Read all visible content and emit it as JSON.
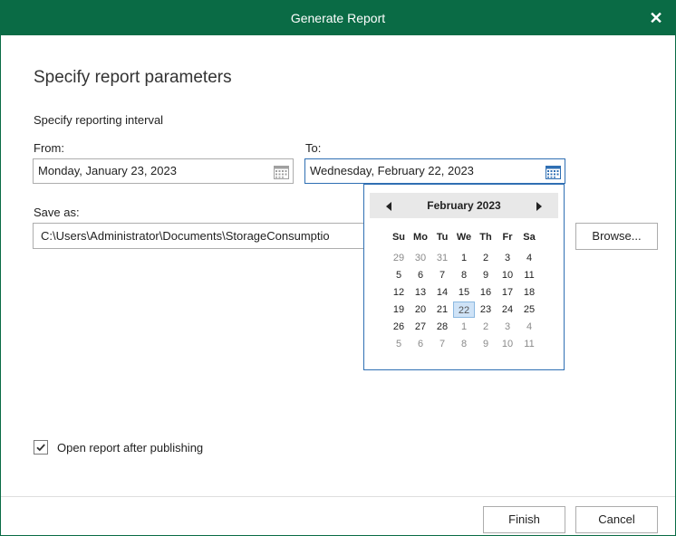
{
  "dialog": {
    "title": "Generate Report",
    "close_glyph": "✕"
  },
  "heading": "Specify report parameters",
  "interval_label": "Specify reporting interval",
  "from": {
    "label": "From:",
    "value": "Monday, January 23, 2023"
  },
  "to": {
    "label": "To:",
    "value": "Wednesday, February 22, 2023"
  },
  "save_as": {
    "label": "Save as:",
    "value": "C:\\Users\\Administrator\\Documents\\StorageConsumptio",
    "browse_label": "Browse..."
  },
  "calendar": {
    "month_label": "February 2023",
    "weekdays": [
      "Su",
      "Mo",
      "Tu",
      "We",
      "Th",
      "Fr",
      "Sa"
    ],
    "selected_day": "22",
    "weeks": [
      [
        {
          "d": "29",
          "o": true
        },
        {
          "d": "30",
          "o": true
        },
        {
          "d": "31",
          "o": true
        },
        {
          "d": "1"
        },
        {
          "d": "2"
        },
        {
          "d": "3"
        },
        {
          "d": "4"
        }
      ],
      [
        {
          "d": "5"
        },
        {
          "d": "6"
        },
        {
          "d": "7"
        },
        {
          "d": "8"
        },
        {
          "d": "9"
        },
        {
          "d": "10"
        },
        {
          "d": "11"
        }
      ],
      [
        {
          "d": "12"
        },
        {
          "d": "13"
        },
        {
          "d": "14"
        },
        {
          "d": "15"
        },
        {
          "d": "16"
        },
        {
          "d": "17"
        },
        {
          "d": "18"
        }
      ],
      [
        {
          "d": "19"
        },
        {
          "d": "20"
        },
        {
          "d": "21"
        },
        {
          "d": "22",
          "s": true
        },
        {
          "d": "23"
        },
        {
          "d": "24"
        },
        {
          "d": "25"
        }
      ],
      [
        {
          "d": "26"
        },
        {
          "d": "27"
        },
        {
          "d": "28"
        },
        {
          "d": "1",
          "o": true
        },
        {
          "d": "2",
          "o": true
        },
        {
          "d": "3",
          "o": true
        },
        {
          "d": "4",
          "o": true
        }
      ],
      [
        {
          "d": "5",
          "o": true
        },
        {
          "d": "6",
          "o": true
        },
        {
          "d": "7",
          "o": true
        },
        {
          "d": "8",
          "o": true
        },
        {
          "d": "9",
          "o": true
        },
        {
          "d": "10",
          "o": true
        },
        {
          "d": "11",
          "o": true
        }
      ]
    ]
  },
  "open_after": {
    "label": "Open report after publishing",
    "checked": true
  },
  "buttons": {
    "finish": "Finish",
    "cancel": "Cancel"
  },
  "icons": {
    "calendar": "calendar-icon",
    "prev": "triangle-left-icon",
    "next": "triangle-right-icon",
    "check": "checkmark-icon"
  },
  "colors": {
    "title_bar": "#0a6b45",
    "popup_border": "#2f6fb3",
    "selected_day_bg": "#cfe3f7"
  }
}
